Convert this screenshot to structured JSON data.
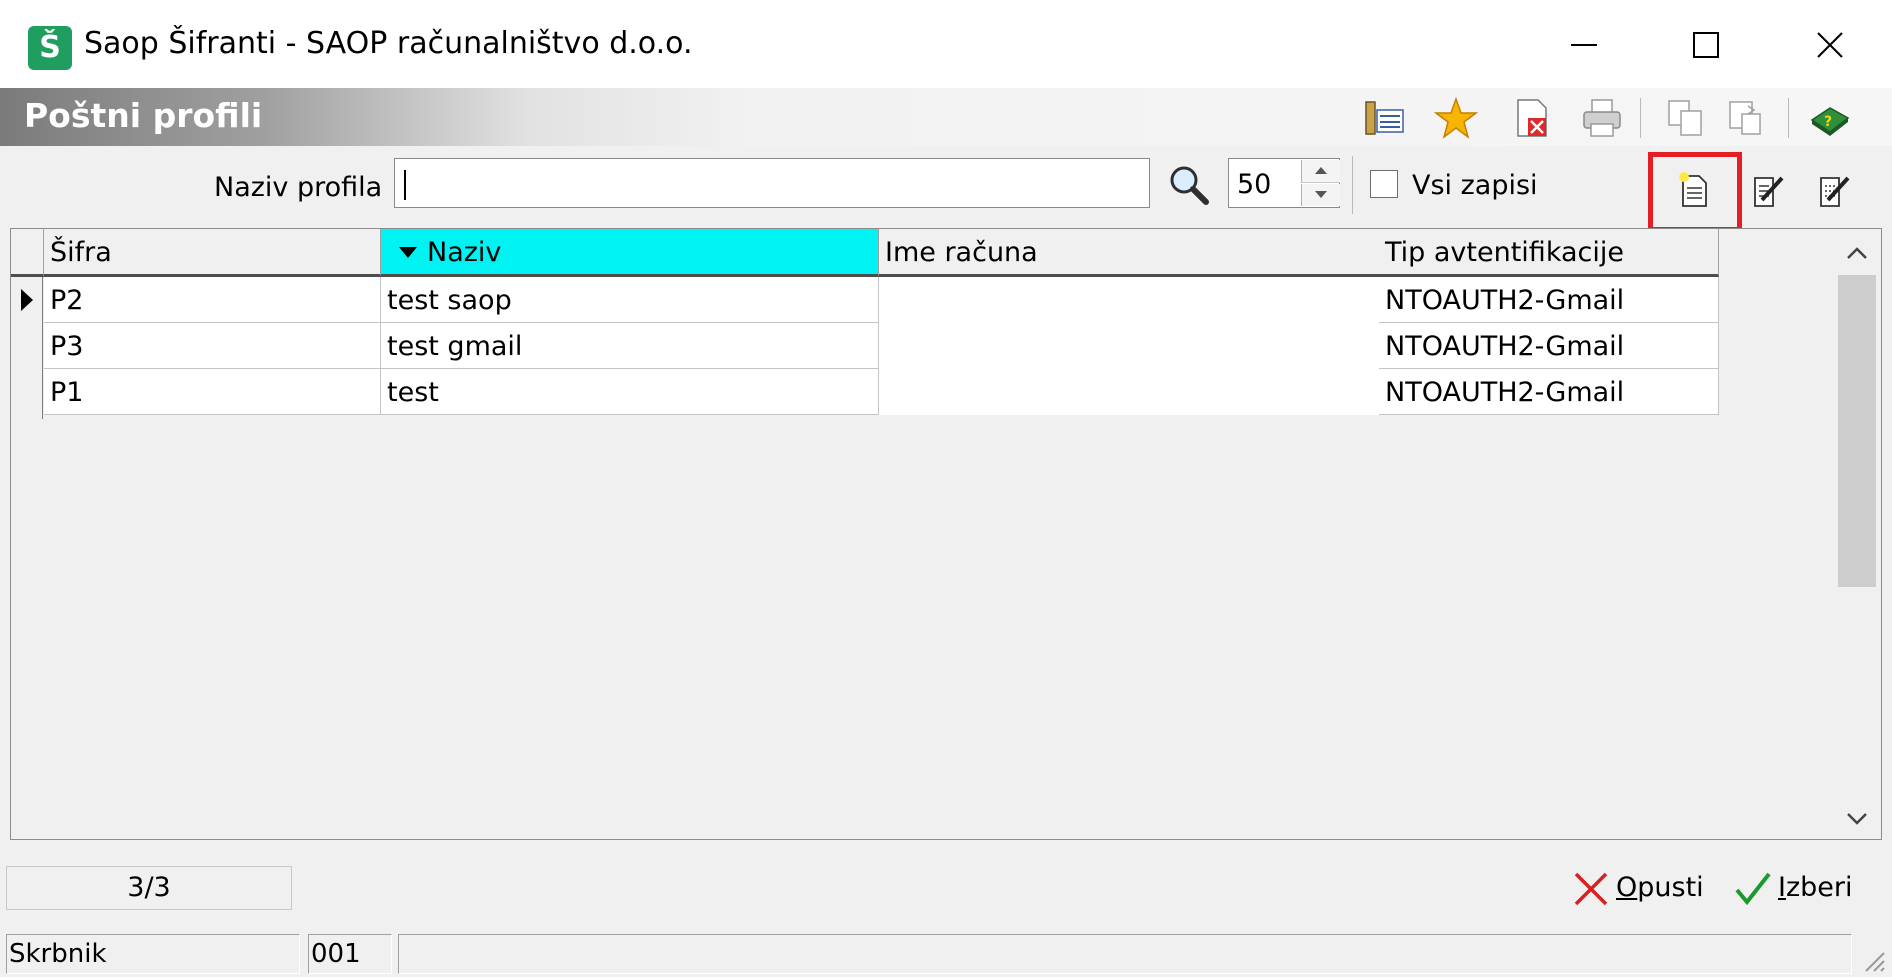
{
  "window": {
    "title": "Saop Šifranti - SAOP računalništvo d.o.o.",
    "logo_letter": "Š",
    "accent": "#1f9e60"
  },
  "header": {
    "title": "Poštni profili",
    "toolbar_icons": [
      "columns-icon",
      "favorite-star-icon",
      "export-delete-icon",
      "print-icon",
      "copy-icon",
      "paste-icon",
      "help-book-icon"
    ]
  },
  "filter": {
    "label": "Naziv profila",
    "value": "",
    "limit": "50",
    "all_records_label": "Vsi zapisi",
    "all_records_checked": false,
    "action_icons": [
      "new-record-icon",
      "edit-record-icon",
      "edit-multiple-icon"
    ]
  },
  "grid": {
    "columns": [
      {
        "label": "Šifra",
        "sorted": false
      },
      {
        "label": "Naziv",
        "sorted": true
      },
      {
        "label": "Ime računa",
        "sorted": false
      },
      {
        "label": "Tip avtentifikacije",
        "sorted": false
      }
    ],
    "rows": [
      {
        "sifra": "P2",
        "naziv": "test saop",
        "ime_racuna": "",
        "tip": "NTOAUTH2-Gmail",
        "current": true
      },
      {
        "sifra": "P3",
        "naziv": "test gmail",
        "ime_racuna": "",
        "tip": "NTOAUTH2-Gmail",
        "current": false
      },
      {
        "sifra": "P1",
        "naziv": "test",
        "ime_racuna": "",
        "tip": "NTOAUTH2-Gmail",
        "current": false
      }
    ],
    "sort_color": "#00f2f2"
  },
  "footer": {
    "counter": "3/3",
    "cancel_label": "Opusti",
    "select_label": "Izberi"
  },
  "status": {
    "user": "Skrbnik",
    "code": "001",
    "message": ""
  }
}
